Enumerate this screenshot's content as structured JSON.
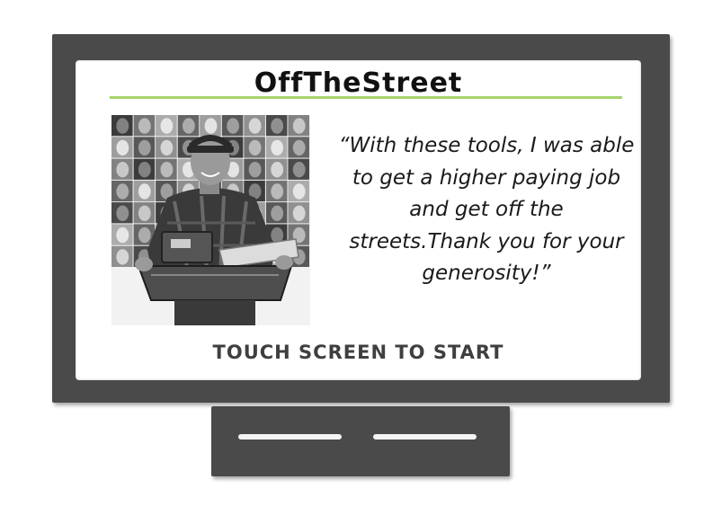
{
  "app": {
    "brand_title": "OffTheStreet"
  },
  "screen": {
    "testimonial_quote": "“With these tools, I was able to get a higher paying job and get off the streets.Thank you for your generosity!”",
    "cta_label": "TOUCH SCREEN TO START"
  },
  "colors": {
    "frame": "#4a4a4a",
    "screen_background": "#ffffff",
    "accent_rule": "#a6d46b",
    "cta_text": "#3f3f3f",
    "slot": "#f4f4f4"
  },
  "icons": {
    "photo": "person-holding-tools-photo"
  }
}
